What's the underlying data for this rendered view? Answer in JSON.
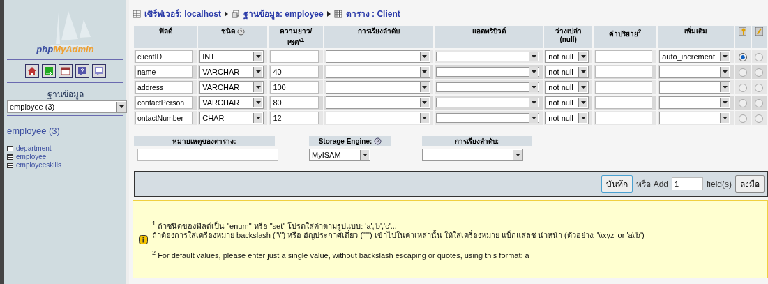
{
  "sidebar": {
    "logo": [
      "php",
      "MyAdmin"
    ],
    "database_label": "ฐานข้อมูล",
    "database_select": "employee (3)",
    "database_heading": "employee (3)",
    "tables": [
      {
        "name": "department"
      },
      {
        "name": "employee"
      },
      {
        "name": "employeeskills"
      }
    ]
  },
  "breadcrumb": [
    {
      "kind": "server",
      "label": "เซิร์ฟเวอร์: localhost"
    },
    {
      "kind": "database",
      "label": "ฐานข้อมูล: employee"
    },
    {
      "kind": "table",
      "label": "ตาราง : Client"
    }
  ],
  "table": {
    "columns": [
      "ฟิลด์",
      "ชนิด",
      "ความยาว/เซต*$^{1}$",
      "การเรียงลำดับ",
      "แอตทริบิวต์",
      "ว่างเปล่า (null)",
      "ค่าปริยาย$^{2}$",
      "เพิ่มเติม"
    ],
    "rows": [
      {
        "field": "clientID",
        "type": "INT",
        "length": "",
        "null": "not null",
        "extra": "auto_increment",
        "primary": true,
        "index": false
      },
      {
        "field": "name",
        "type": "VARCHAR",
        "length": "40",
        "null": "not null",
        "primary": false,
        "index": false
      },
      {
        "field": "address",
        "type": "VARCHAR",
        "length": "100",
        "null": "not null",
        "primary": false,
        "index": false
      },
      {
        "field": "contactPerson",
        "type": "VARCHAR",
        "length": "80",
        "null": "not null",
        "primary": false,
        "index": false
      },
      {
        "field": "ontactNumber",
        "type": "CHAR",
        "length": "12",
        "null": "not null",
        "primary": false,
        "index": false
      }
    ]
  },
  "options": {
    "comment_label": "หมายเหตุของตาราง:",
    "engine_label": "Storage Engine:",
    "engine": "MyISAM",
    "collation_label": "การเรียงลำดับ:"
  },
  "save_bar": {
    "save": "บันทึก",
    "or_add": "หรือ Add",
    "count": "1",
    "fields": "field(s)",
    "go": "ลงมือ"
  },
  "note": [
    "$^{1}$ ถ้าชนิดของฟิลด์เป็น \"enum\" หรือ \"set\" โปรดใส่ค่าตามรูปแบบ: 'a','b','c'...",
    "ถ้าต้องการใส่เครื่องหมาย backslash (\"\\\") หรือ อัญประกาศเดี่ยว (\"'\") เข้าไปในค่าเหล่านั้น ให้ใส่เครื่องหมาย แบ็กแสลช นำหน้า (ตัวอย่าง: '\\\\xyz' or 'a\\'b')",
    "$^{2}$ For default values, please enter just a single value, without backslash escaping or quotes, using this format: a"
  ]
}
